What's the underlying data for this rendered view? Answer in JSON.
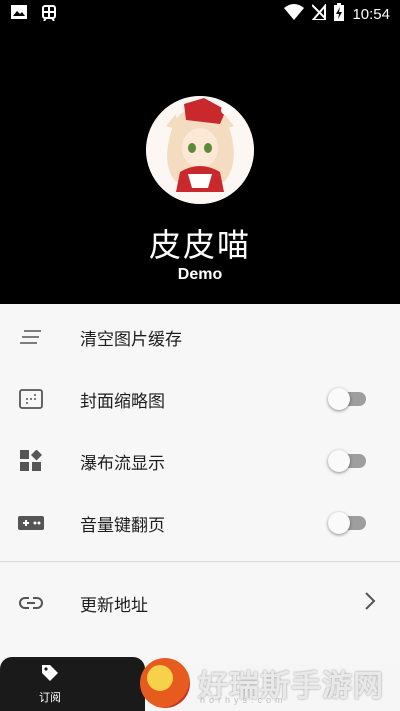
{
  "status_bar": {
    "time": "10:54",
    "icons": [
      "image-icon",
      "bug-icon",
      "wifi-icon",
      "sim-off-icon",
      "battery-charging-icon"
    ]
  },
  "profile": {
    "avatar": "cat-girl-avatar",
    "title": "皮皮喵",
    "subtitle": "Demo"
  },
  "menu": {
    "items": [
      {
        "label": "清空图片缓存",
        "icon": "clear-list-icon",
        "control": "none"
      },
      {
        "label": "封面缩略图",
        "icon": "image-placeholder-icon",
        "control": "toggle",
        "on": false
      },
      {
        "label": "瀑布流显示",
        "icon": "dashboard-icon",
        "control": "toggle",
        "on": false
      },
      {
        "label": "音量键翻页",
        "icon": "gamepad-icon",
        "control": "toggle",
        "on": false
      },
      {
        "label": "更新地址",
        "icon": "link-icon",
        "control": "chevron"
      }
    ]
  },
  "bottom_nav": {
    "subscribe_label": "订阅"
  },
  "watermark": {
    "text": "好瑞斯手游网",
    "url": "horhys.com"
  },
  "colors": {
    "header_bg": "#000000",
    "menu_bg": "#f7f7f7",
    "toggle_track": "#9e9e9e",
    "toggle_knob": "#fafafa"
  }
}
